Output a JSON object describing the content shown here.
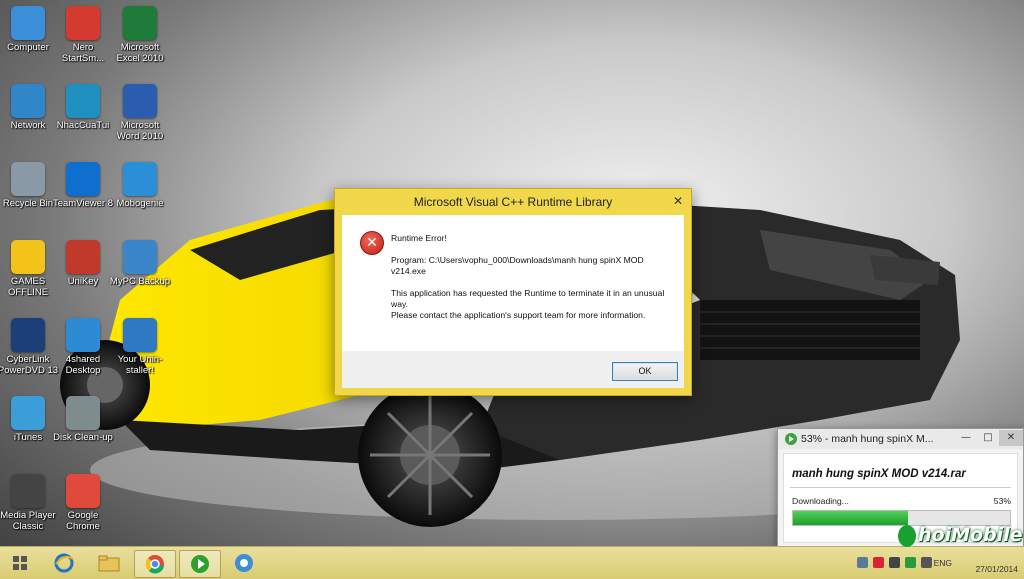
{
  "desktop": {
    "icons": [
      {
        "label": "Computer",
        "icon": "computer-icon",
        "color": "#3b8fd8"
      },
      {
        "label": "Nero StartSm...",
        "icon": "nero-icon",
        "color": "#d43a2f"
      },
      {
        "label": "Microsoft Excel 2010",
        "icon": "excel-icon",
        "color": "#1e7b3a"
      },
      {
        "label": "Network",
        "icon": "network-icon",
        "color": "#2f86c9"
      },
      {
        "label": "NhacCuaTui",
        "icon": "nhaccuatui-icon",
        "color": "#1f8fc0"
      },
      {
        "label": "Microsoft Word 2010",
        "icon": "word-icon",
        "color": "#2a5db0"
      },
      {
        "label": "Recycle Bin",
        "icon": "recycle-bin-icon",
        "color": "#8a99a6"
      },
      {
        "label": "TeamViewer 8",
        "icon": "teamviewer-icon",
        "color": "#0e6fcf"
      },
      {
        "label": "Mobogenie",
        "icon": "mobogenie-icon",
        "color": "#2a8fd6"
      },
      {
        "label": "GAMES OFFLINE",
        "icon": "star-icon",
        "color": "#f2c318"
      },
      {
        "label": "UniKey",
        "icon": "unikey-icon",
        "color": "#c0392b"
      },
      {
        "label": "MyPC Backup",
        "icon": "mypc-backup-icon",
        "color": "#3a86c8"
      },
      {
        "label": "CyberLink PowerDVD 13",
        "icon": "powerdvd-icon",
        "color": "#1a3f79"
      },
      {
        "label": "4shared Desktop",
        "icon": "4shared-icon",
        "color": "#2d8bd3"
      },
      {
        "label": "Your Unin-staller!",
        "icon": "uninstaller-icon",
        "color": "#2f78c2"
      },
      {
        "label": "iTunes",
        "icon": "itunes-icon",
        "color": "#3b9ed8"
      },
      {
        "label": "Disk Clean-up",
        "icon": "disk-cleanup-icon",
        "color": "#7f8c8d"
      },
      {
        "label": "Media Player Classic",
        "icon": "media-player-icon",
        "color": "#444444"
      },
      {
        "label": "Google Chrome",
        "icon": "chrome-icon",
        "color": "#e0493c"
      }
    ]
  },
  "dialog": {
    "title": "Microsoft Visual C++ Runtime Library",
    "close_glyph": "✕",
    "error_glyph": "✕",
    "line1": "Runtime Error!",
    "line2": "Program: C:\\Users\\vophu_000\\Downloads\\manh hung spinX MOD v214.exe",
    "line3": "This application has requested the Runtime to terminate it in an unusual way.",
    "line4": "Please contact the application's support team for more information.",
    "ok": "OK"
  },
  "download": {
    "title": "53% - manh hung spinX M...",
    "filename": "manh hung spinX MOD v214.rar",
    "status": "Downloading...",
    "percent": "53%",
    "progress": 0.53
  },
  "taskbar": {
    "lang": "ENG",
    "date": "27/01/2014"
  },
  "watermark": {
    "text": "hoiMobile"
  },
  "colors": {
    "dialog_frame": "#f0d84a",
    "taskbar": "#e2d586",
    "progress": "#2bb33a"
  }
}
